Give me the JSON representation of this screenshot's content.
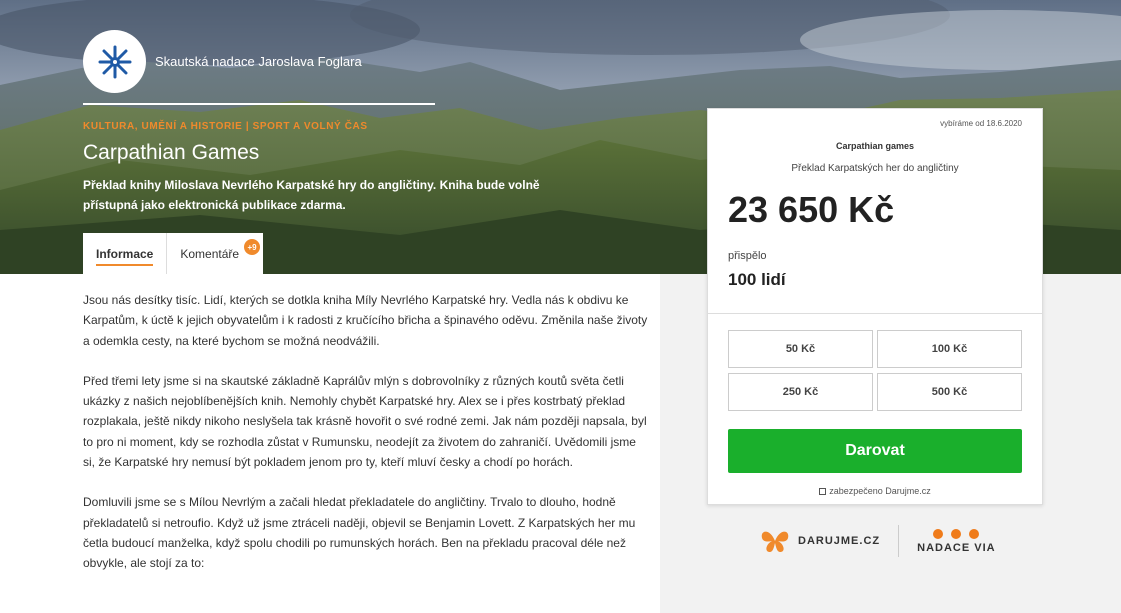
{
  "organization": {
    "name": "Skautská nadace Jaroslava Foglara",
    "logo_icon": "snowflake-icon",
    "logo_color": "#1f5aa6"
  },
  "project": {
    "category": "KULTURA, UMĚNÍ A HISTORIE | SPORT A VOLNÝ ČAS",
    "title": "Carpathian Games",
    "description": "Překlad knihy Miloslava Nevrlého Karpatské hry do angličtiny. Kniha bude volně přístupná jako elektronická publikace zdarma."
  },
  "tabs": [
    {
      "label": "Informace",
      "active": true
    },
    {
      "label": "Komentáře",
      "badge": "+9",
      "active": false
    }
  ],
  "content": {
    "paragraphs": [
      "Jsou nás desítky tisíc. Lidí, kterých se dotkla kniha Míly Nevrlého Karpatské hry. Vedla nás k obdivu ke Karpatům, k úctě k jejich obyvatelům i k radosti z kručícího břicha a špinavého oděvu. Změnila naše životy a odemkla cesty, na které bychom se možná neodvážili.",
      "Před třemi lety jsme si na skautské základně Kaprálův mlýn s dobrovolníky z různých koutů světa četli ukázky z našich nejoblíbenějších knih. Nemohly chybět Karpatské hry. Alex se i přes kostrbatý překlad rozplakala, ještě nikdy nikoho neslyšela tak krásně hovořit o své rodné zemi. Jak nám později napsala, byl to pro ni moment, kdy se rozhodla zůstat v Rumunsku, neodejít za životem do zahraničí. Uvědomili jsme si, že Karpatské hry nemusí být pokladem jenom pro ty, kteří mluví česky a chodí po horách.",
      "Domluvili jsme se s Mílou Nevrlým a začali hledat překladatele do angličtiny. Trvalo to dlouho, hodně překladatelů si netroufio. Když už jsme ztráceli naději, objevil se Benjamin Lovett. Z Karpatských her mu četla budoucí manželka, když spolu chodili po rumunských horách. Ben na překladu pracoval déle než obvykle, ale stojí za to:"
    ]
  },
  "donation": {
    "since": "vybíráme od 18.6.2020",
    "title": "Carpathian games",
    "subtitle": "Překlad Karpatských her do angličtiny",
    "amount": "23 650 Kč",
    "contributed_label": "přispělo",
    "contributed_value": "100 lidí",
    "amount_options": [
      "50 Kč",
      "100 Kč",
      "250 Kč",
      "500 Kč"
    ],
    "donate_label": "Darovat",
    "secure_text": "zabezpečeno Darujme.cz",
    "donate_color": "#1aaf2c"
  },
  "partners": {
    "darujme": "DARUJME.CZ",
    "nadace_via": "NADACE VIA"
  },
  "accent_color": "#f08a2c"
}
